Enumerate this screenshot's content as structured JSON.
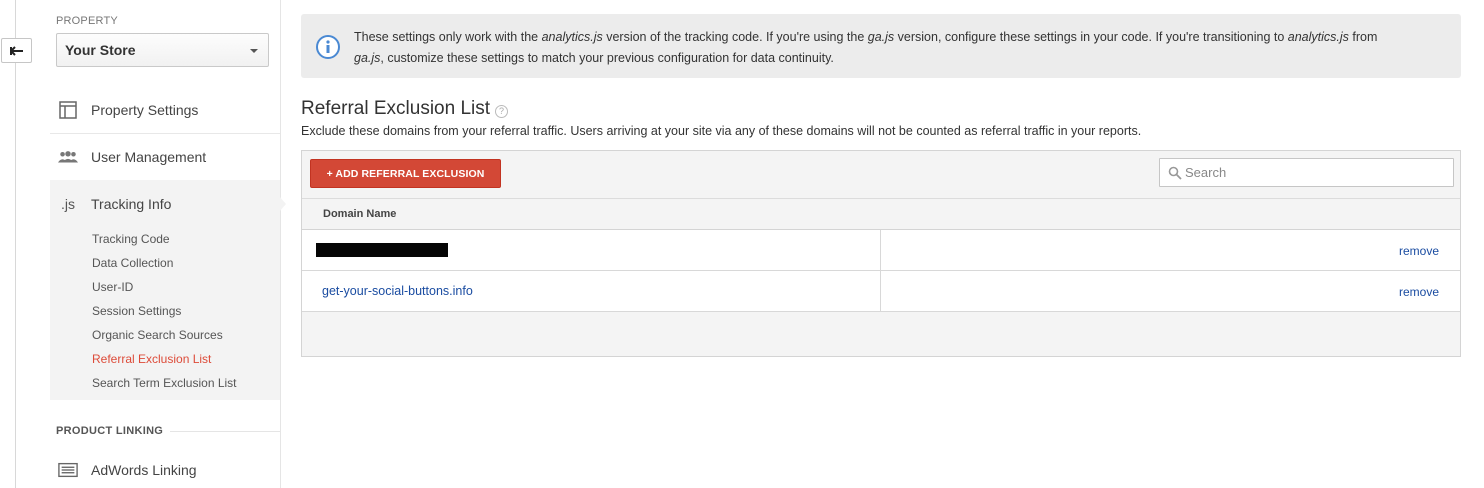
{
  "rail": {
    "back_icon": "back-arrow-icon"
  },
  "sidebar": {
    "property_label": "PROPERTY",
    "property_selected": "Your Store",
    "nav": [
      {
        "label": "Property Settings",
        "icon": "property-settings-icon"
      },
      {
        "label": "User Management",
        "icon": "users-icon"
      },
      {
        "label": "Tracking Info",
        "icon": ".js"
      }
    ],
    "tracking_sub": [
      {
        "label": "Tracking Code",
        "active": false
      },
      {
        "label": "Data Collection",
        "active": false
      },
      {
        "label": "User-ID",
        "active": false
      },
      {
        "label": "Session Settings",
        "active": false
      },
      {
        "label": "Organic Search Sources",
        "active": false
      },
      {
        "label": "Referral Exclusion List",
        "active": true
      },
      {
        "label": "Search Term Exclusion List",
        "active": false
      }
    ],
    "section_label": "PRODUCT LINKING",
    "adwords_label": "AdWords Linking",
    "active_color": "#dd4b39"
  },
  "main": {
    "info": {
      "prefix": "These settings only work with the ",
      "analytics1": "analytics.js",
      "mid1": " version of the tracking code. If you're using the ",
      "gajs1": "ga.js",
      "mid2": " version, configure these settings in your code. If you're transitioning to ",
      "analytics2": "analytics.js",
      "mid3": " from ",
      "gajs2": "ga.js",
      "suffix": ", customize these settings to match your previous configuration for data continuity."
    },
    "title": "Referral Exclusion List",
    "help_glyph": "?",
    "description": "Exclude these domains from your referral traffic. Users arriving at your site via any of these domains will not be counted as referral traffic in your reports.",
    "add_button": "+ ADD REFERRAL EXCLUSION",
    "search_placeholder": "Search",
    "column_header": "Domain Name",
    "rows": [
      {
        "domain": "",
        "redacted": true,
        "action": "remove"
      },
      {
        "domain": "get-your-social-buttons.info",
        "redacted": false,
        "action": "remove"
      }
    ],
    "accent_button": "#d34836",
    "link_color": "#1a4ca1"
  }
}
